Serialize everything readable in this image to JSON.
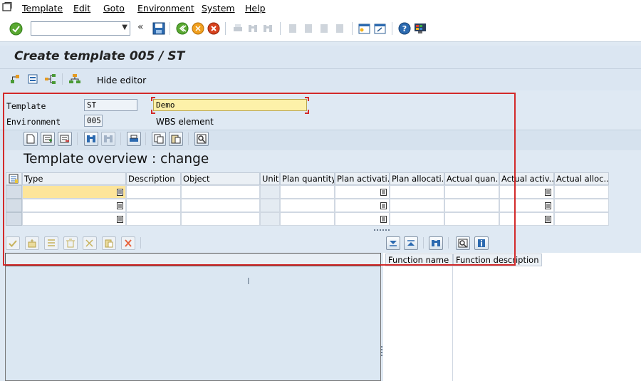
{
  "menu": {
    "items": [
      {
        "label": "Template"
      },
      {
        "label": "Edit"
      },
      {
        "label": "Goto"
      },
      {
        "label": "Environment"
      },
      {
        "label": "System"
      },
      {
        "label": "Help"
      }
    ]
  },
  "toolbar": {
    "command_field": {
      "value": ""
    },
    "icons": [
      "enter-icon",
      "back-icon",
      "save-icon",
      "back-green-icon",
      "exit-icon",
      "cancel-icon",
      "print-icon",
      "find-icon",
      "find-next-icon",
      "first-page-icon",
      "prev-page-icon",
      "next-page-icon",
      "last-page-icon",
      "create-session-icon",
      "shortcut-icon",
      "help-icon",
      "layout-icon"
    ]
  },
  "page": {
    "title": "Create template 005 / ST"
  },
  "app_toolbar": {
    "hide_editor_label": "Hide editor"
  },
  "form": {
    "template_label": "Template",
    "template_value": "ST",
    "template_desc_value": "Demo",
    "environment_label": "Environment",
    "environment_value": "005",
    "environment_desc": "WBS element"
  },
  "overview": {
    "title": "Template overview : change"
  },
  "table": {
    "columns": [
      "Type",
      "Description",
      "Object",
      "Unit",
      "Plan quantity",
      "Plan activati...",
      "Plan allocati...",
      "Actual quan...",
      "Actual activ...",
      "Actual alloc..."
    ],
    "rows": [
      [
        "",
        "",
        "",
        "",
        "",
        "",
        "",
        "",
        "",
        ""
      ],
      [
        "",
        "",
        "",
        "",
        "",
        "",
        "",
        "",
        "",
        ""
      ],
      [
        "",
        "",
        "",
        "",
        "",
        "",
        "",
        "",
        "",
        ""
      ]
    ]
  },
  "function_list": {
    "columns": [
      "Function name",
      "Function description"
    ]
  },
  "colors": {
    "frame": "#d32a2a",
    "active_field": "#fdf1a9",
    "selected_cell": "#fde59a"
  }
}
